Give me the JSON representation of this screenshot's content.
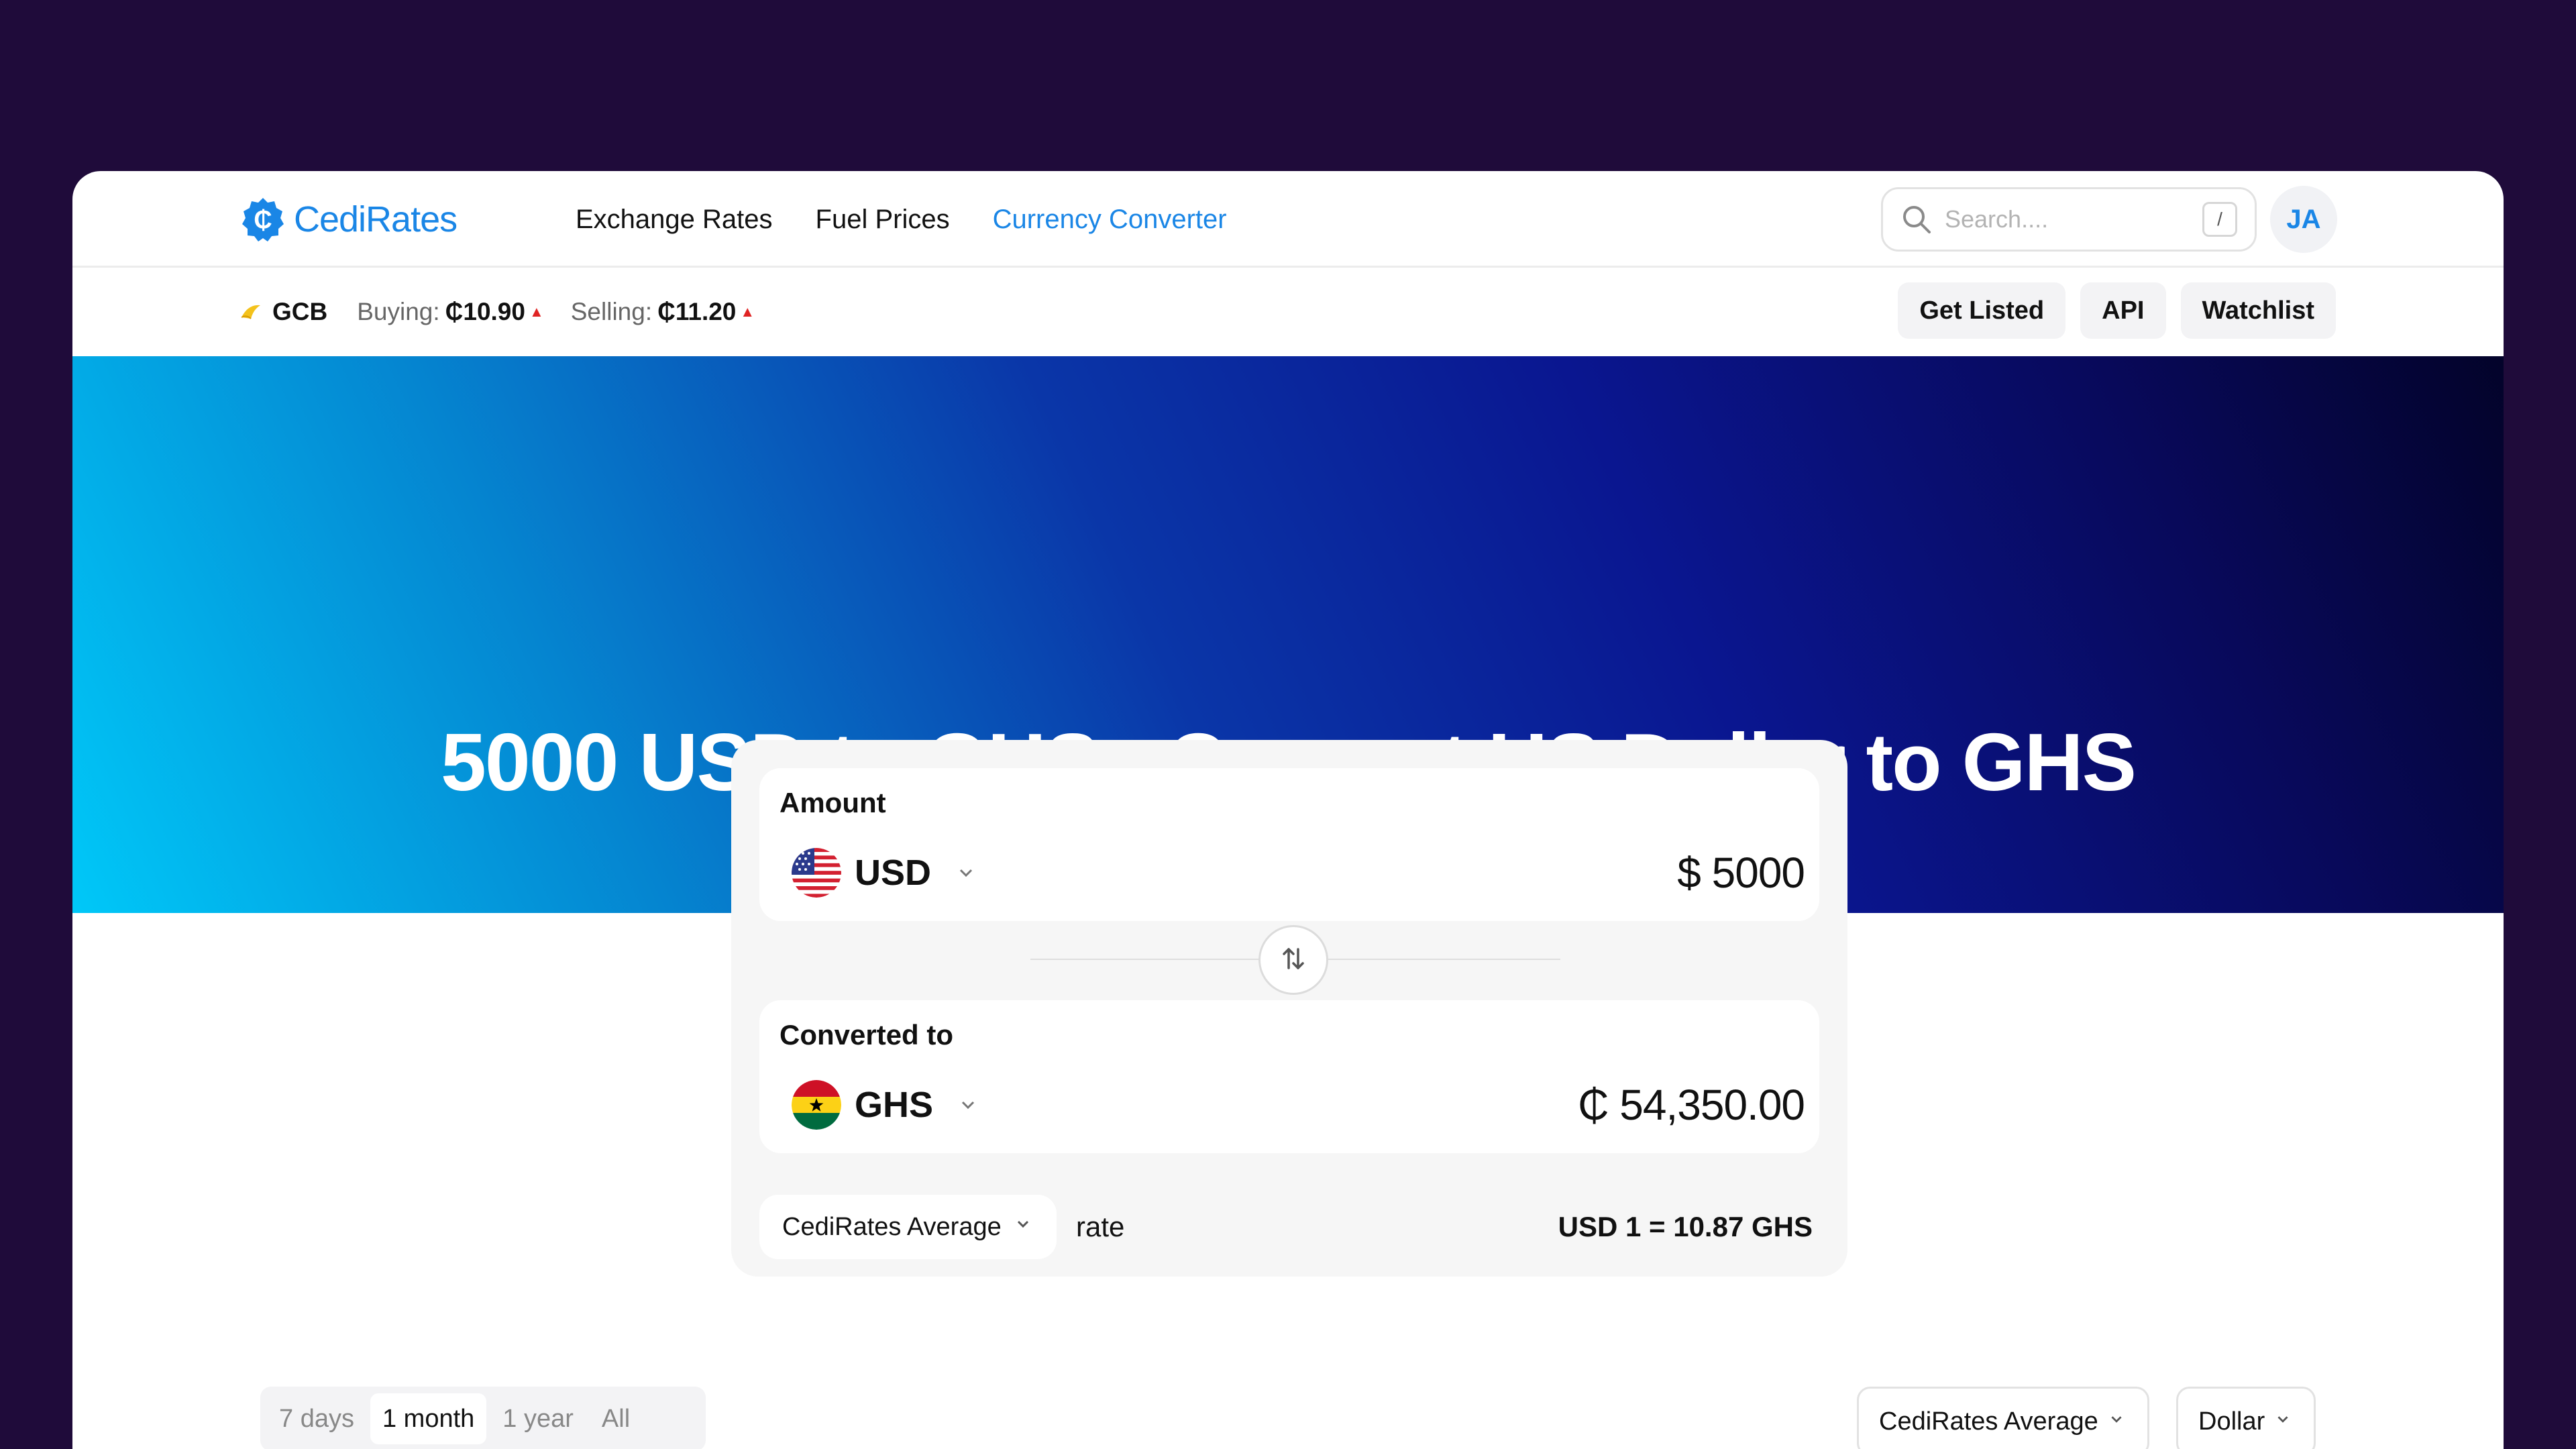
{
  "brand": {
    "name": "CediRates",
    "color": "#1a86e6"
  },
  "nav": {
    "links": [
      {
        "label": "Exchange Rates",
        "active": false
      },
      {
        "label": "Fuel Prices",
        "active": false
      },
      {
        "label": "Currency Converter",
        "active": true
      }
    ],
    "search_placeholder": "Search....",
    "search_shortcut": "/",
    "avatar_initials": "JA"
  },
  "ticker": {
    "bank": "GCB",
    "buying_label": "Buying:",
    "buying_value": "₵10.90",
    "selling_label": "Selling:",
    "selling_value": "₵11.20",
    "trend_color": "#e02424"
  },
  "sub_buttons": [
    "Get Listed",
    "API",
    "Watchlist"
  ],
  "hero": {
    "title": "5000 USD to GHS - Convert US Dollar to GHS"
  },
  "converter": {
    "amount_label": "Amount",
    "from_currency": "USD",
    "from_value": "$ 5000",
    "converted_label": "Converted to",
    "to_currency": "GHS",
    "to_value": "₵ 54,350.00",
    "rate_source": "CediRates Average",
    "rate_word": "rate",
    "rate_equation": "USD 1 = 10.87 GHS"
  },
  "chart_controls": {
    "ranges": [
      {
        "label": "7 days",
        "active": false
      },
      {
        "label": "1 month",
        "active": true
      },
      {
        "label": "1 year",
        "active": false
      },
      {
        "label": "All",
        "active": false
      }
    ],
    "source": "CediRates Average",
    "unit": "Dollar"
  }
}
